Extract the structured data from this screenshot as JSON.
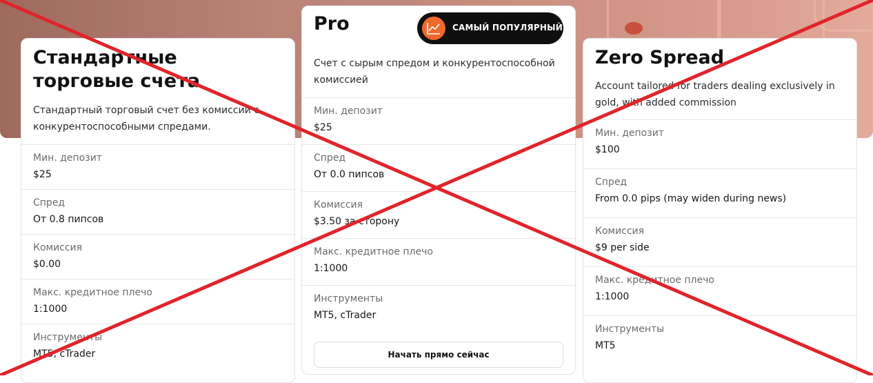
{
  "accounts": {
    "standard": {
      "title": "Стандартные торговые счета",
      "description": "Стандартный торговый счет без комиссии с конкурентоспособными спредами.",
      "rows": [
        {
          "label": "Мин. депозит",
          "value": "$25"
        },
        {
          "label": "Спред",
          "value": "От 0.8 пипсов"
        },
        {
          "label": "Комиссия",
          "value": "$0.00"
        },
        {
          "label": "Макс. кредитное плечо",
          "value": "1:1000"
        },
        {
          "label": "Инструменты",
          "value": "MT5, cTrader"
        }
      ]
    },
    "pro": {
      "title": "Pro",
      "badge": "САМЫЙ ПОПУЛЯРНЫЙ",
      "description": "Счет с сырым спредом и конкурентоспособной комиссией",
      "rows": [
        {
          "label": "Мин. депозит",
          "value": "$25"
        },
        {
          "label": "Спред",
          "value": "От 0.0 пипсов"
        },
        {
          "label": "Комиссия",
          "value": "$3.50 за сторону"
        },
        {
          "label": "Макс. кредитное плечо",
          "value": "1:1000"
        },
        {
          "label": "Инструменты",
          "value": "MT5, cTrader"
        }
      ],
      "cta": "Начать прямо сейчас"
    },
    "zero": {
      "title": "Zero Spread",
      "description": "Account tailored for traders dealing exclusively in gold, with added commission",
      "rows": [
        {
          "label": "Мин. депозит",
          "value": "$100"
        },
        {
          "label": "Спред",
          "value": "From 0.0 pips (may widen during news)"
        },
        {
          "label": "Комиссия",
          "value": "$9 per side"
        },
        {
          "label": "Макс. кредитное плечо",
          "value": "1:1000"
        },
        {
          "label": "Инструменты",
          "value": "MT5"
        }
      ]
    }
  },
  "colors": {
    "badge_background": "#0f0f0f",
    "badge_icon": "#ef6a2f",
    "cross_overlay": "#e0242b"
  },
  "icons": {
    "badge": "trending-up-icon"
  }
}
